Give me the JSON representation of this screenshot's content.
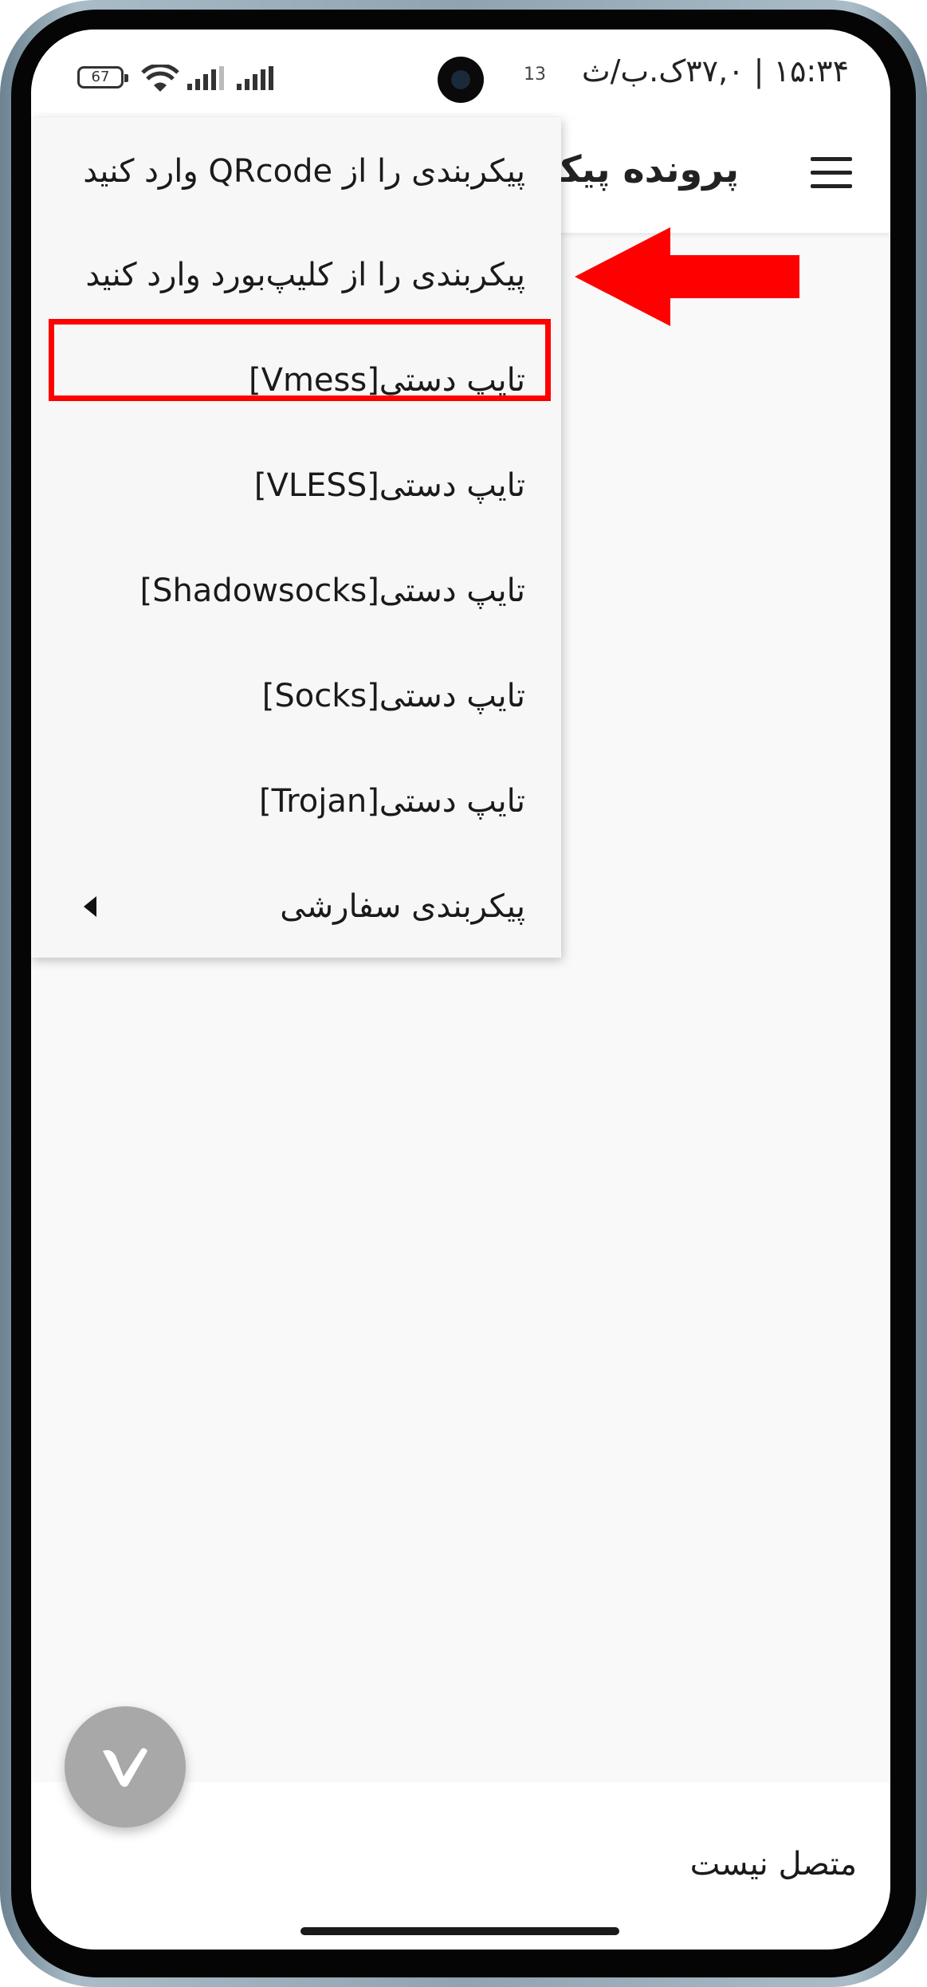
{
  "status_bar": {
    "time": "۱۵:۳۴ | ۳۷,۰ک.ب/ث",
    "notification_count": "13",
    "battery": "67"
  },
  "toolbar": {
    "title": "پرونده پیکربندی"
  },
  "menu": {
    "items": [
      {
        "label": "پیکربندی را از QRcode وارد کنید"
      },
      {
        "label": "پیکربندی را از کلیپ‌بورد وارد کنید"
      },
      {
        "label": "تایپ دستی[Vmess]"
      },
      {
        "label": "تایپ دستی[VLESS]"
      },
      {
        "label": "تایپ دستی[Shadowsocks]"
      },
      {
        "label": "تایپ دستی[Socks]"
      },
      {
        "label": "تایپ دستی[Trojan]"
      },
      {
        "label": "پیکربندی سفارشی"
      }
    ]
  },
  "bottom": {
    "connection_status": "متصل نیست",
    "fab_icon": "v2ray-logo-icon"
  },
  "annotation": {
    "highlight_color": "#ff0000"
  }
}
